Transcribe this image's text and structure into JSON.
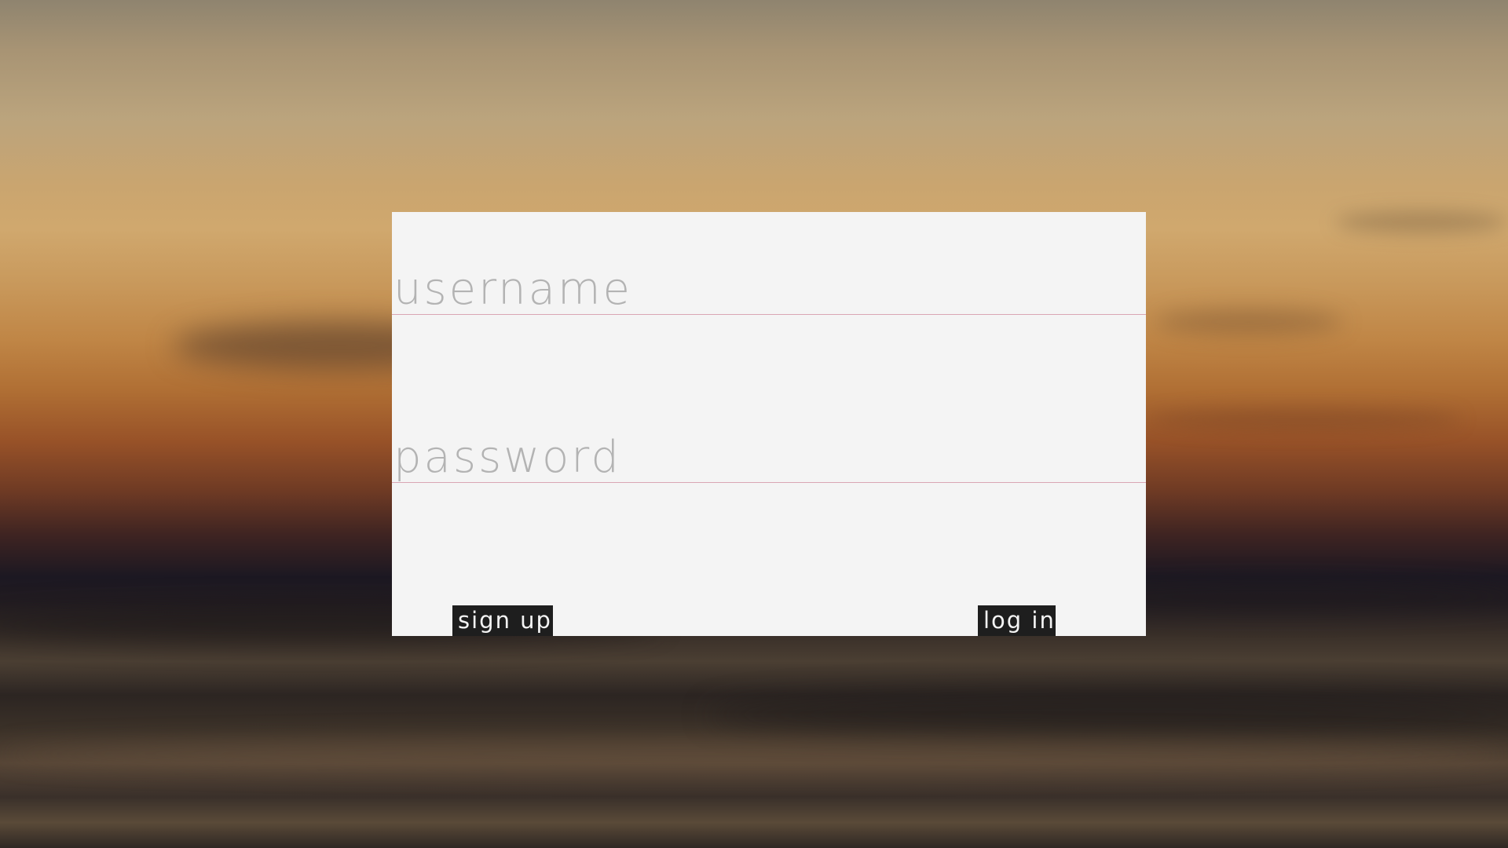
{
  "login_form": {
    "username": {
      "placeholder": "username",
      "value": ""
    },
    "password": {
      "placeholder": "password",
      "value": ""
    },
    "sign_up_label": "sign up",
    "log_in_label": "log in"
  },
  "colors": {
    "card_background": "#f4f4f4",
    "placeholder_text": "#b3b3b3",
    "field_underline": "#d9a6b3",
    "button_background": "#1e1e1e",
    "button_text": "#f4f4f4"
  }
}
